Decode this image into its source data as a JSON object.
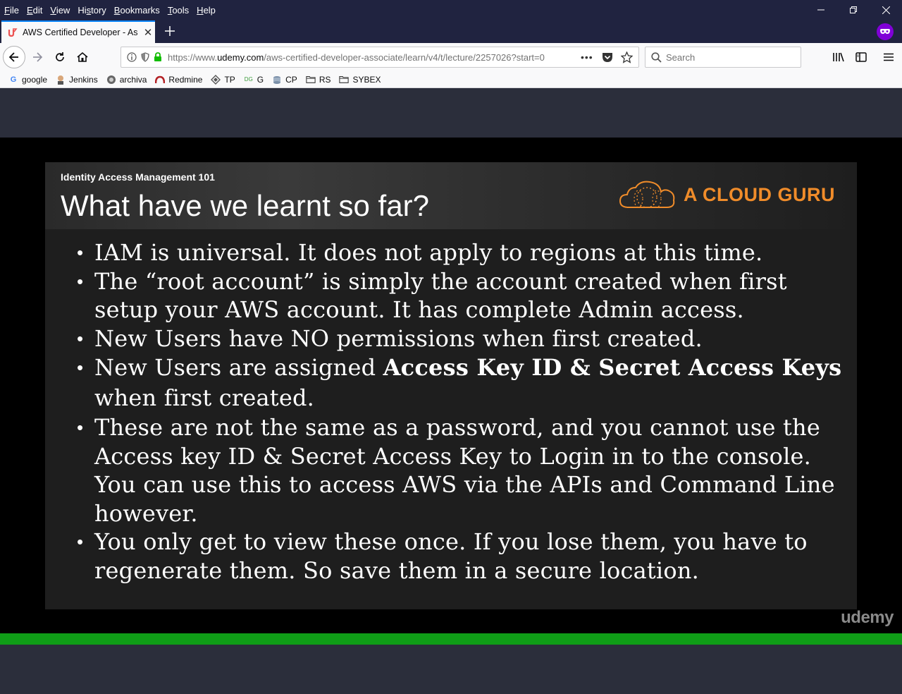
{
  "menu": [
    "File",
    "Edit",
    "View",
    "History",
    "Bookmarks",
    "Tools",
    "Help"
  ],
  "menu_access_keys": [
    "F",
    "E",
    "V",
    "s",
    "B",
    "T",
    "H"
  ],
  "tab": {
    "title": "AWS Certified Developer - Associate"
  },
  "url": {
    "prefix": "https://www.",
    "domain": "udemy.com",
    "path": "/aws-certified-developer-associate/learn/v4/t/lecture/2257026?start=0"
  },
  "search": {
    "placeholder": "Search"
  },
  "bookmarks": [
    "google",
    "Jenkins",
    "archiva",
    "Redmine",
    "TP",
    "G",
    "CP",
    "RS",
    "SYBEX"
  ],
  "slide": {
    "subtitle": "Identity Access Management 101",
    "title": "What have we learnt so far?",
    "logo_text": "A CLOUD GURU",
    "bullets": {
      "b1": "IAM is universal. It does not apply to regions at this time.",
      "b2": "The “root account” is simply the account created when first setup your AWS account. It has complete Admin access.",
      "b3": "New Users have NO permissions when first created.",
      "b4_pre": "New Users are assigned ",
      "b4_bold": "Access Key ID & Secret Access Keys",
      "b4_post": " when first created.",
      "b5": "These are not the same as a password, and you cannot use the Access key ID & Secret Access Key to Login in to the console. You can use this to access AWS via the APIs and Command Line however.",
      "b6": "You only get to view these once. If you lose them, you have to regenerate them. So save them in a secure location."
    }
  },
  "watermark": "udemy",
  "colors": {
    "accent": "#0a84ff",
    "progress": "#0f9d17",
    "logo": "#f08c2a",
    "private": "#8000d7"
  }
}
